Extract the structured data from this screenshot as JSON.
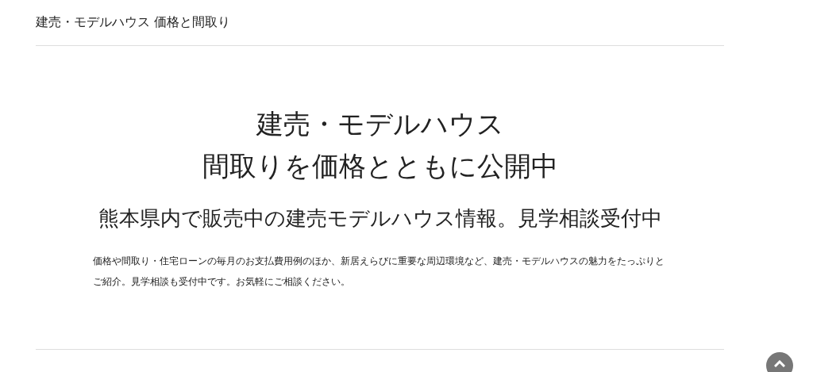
{
  "header": {
    "title": "建売・モデルハウス 価格と間取り"
  },
  "hero": {
    "heading_lines": [
      "建売・モデルハウス",
      "間取りを価格とともに公開中"
    ],
    "subheading": "熊本県内で販売中の建売モデルハウス情報。見学相談受付中",
    "description": "価格や間取り・住宅ローンの毎月のお支払費用例のほか、新居えらびに重要な周辺環境など、建売・モデルハウスの魅力をたっぷりとご紹介。見学相談も受付中です。お気軽にご相談ください。"
  },
  "scroll_top_button": {
    "kind": "up"
  }
}
